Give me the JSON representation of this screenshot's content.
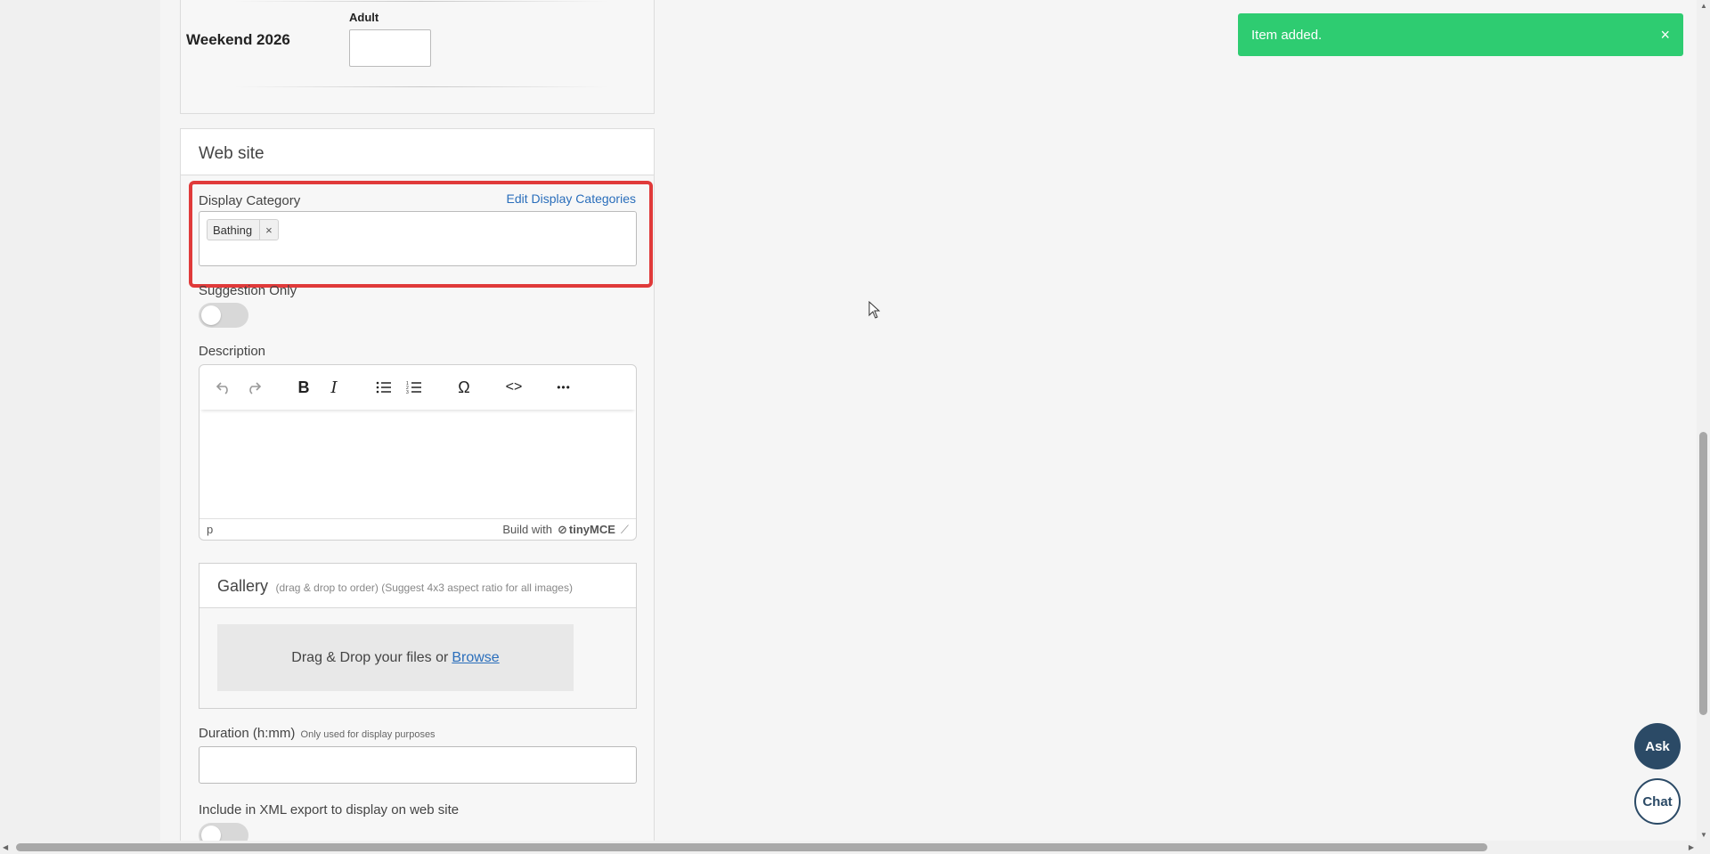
{
  "pricing": {
    "season_name": "Weekend 2026",
    "adult_label": "Adult",
    "adult_value": ""
  },
  "website_section": {
    "title": "Web site",
    "display_category": {
      "label": "Display Category",
      "edit_link": "Edit Display Categories",
      "tags": [
        {
          "label": "Bathing",
          "remove": "×"
        }
      ]
    },
    "suggestion_only": {
      "label": "Suggestion Only",
      "on": false
    },
    "description": {
      "label": "Description",
      "toolbar": {
        "undo": "undo-icon",
        "redo": "redo-icon",
        "bold": "B",
        "italic": "I",
        "bullet_list": "bullet-list-icon",
        "numbered_list": "numbered-list-icon",
        "special_char": "Ω",
        "code": "<>",
        "more": "•••"
      },
      "status_path": "p",
      "branding": "Build with",
      "brand_name": "tinyMCE"
    },
    "gallery": {
      "title": "Gallery",
      "hint": "(drag & drop to order) (Suggest 4x3 aspect ratio for all images)",
      "dropzone_text": "Drag & Drop your files or",
      "browse_link": "Browse"
    },
    "duration": {
      "label": "Duration (h:mm)",
      "hint": "Only used for display purposes",
      "value": ""
    },
    "xml_export": {
      "label": "Include in XML export to display on web site",
      "on": false
    }
  },
  "toast": {
    "message": "Item added.",
    "close": "×",
    "color": "#2ecc71"
  },
  "floating": {
    "ask": "Ask",
    "chat": "Chat"
  },
  "colors": {
    "highlight": "#e03a3a",
    "link": "#2a6ebb",
    "fab": "#2b4a66"
  }
}
